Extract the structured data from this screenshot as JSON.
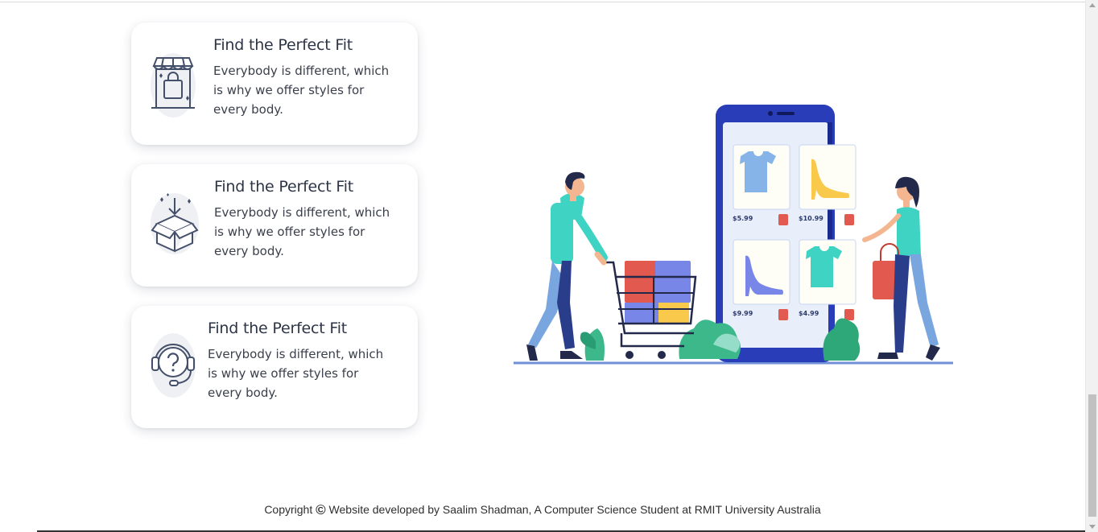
{
  "features": [
    {
      "icon": "shop-bag-icon",
      "title": "Find the Perfect Fit",
      "description": "Everybody is different, which is why we offer styles for every body."
    },
    {
      "icon": "open-box-icon",
      "title": "Find the Perfect Fit",
      "description": "Everybody is different, which is why we offer styles for every body."
    },
    {
      "icon": "support-headset-icon",
      "title": "Find the Perfect Fit",
      "description": "Everybody is different, which is why we offer styles for every body."
    }
  ],
  "illustration": {
    "prices": [
      "$5.99",
      "$10.99",
      "$9.99",
      "$4.99"
    ],
    "colors": {
      "phone": "#2a3db8",
      "screen": "#e9eefb",
      "shirt_blue": "#86b4e8",
      "shoe_yellow": "#f8c94a",
      "shoe_purple": "#7886e8",
      "shirt_teal": "#3fd3c3",
      "bag_red": "#e25a4f",
      "leaf_green": "#3cb88a"
    }
  },
  "footer": {
    "prefix": "Copyright",
    "symbol": "©",
    "text": "Website developed by Saalim Shadman, A Computer Science Student at RMIT University Australia"
  }
}
